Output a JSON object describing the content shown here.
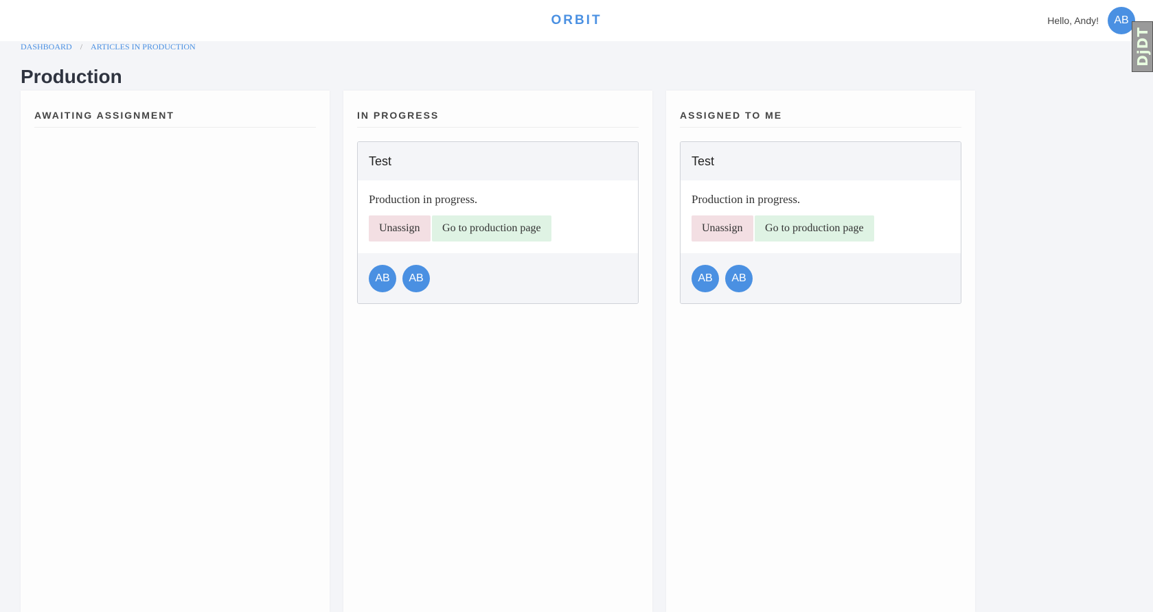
{
  "header": {
    "brand": "ORBIT",
    "greeting": "Hello, Andy!",
    "user_initials": "AB",
    "debug_toolbar": "DjDT"
  },
  "breadcrumb": {
    "items": [
      "DASHBOARD",
      "ARTICLES IN PRODUCTION"
    ],
    "separator": "/"
  },
  "page_title": "Production",
  "columns": [
    {
      "title": "AWAITING ASSIGNMENT",
      "cards": []
    },
    {
      "title": "IN PROGRESS",
      "cards": [
        {
          "title": "Test",
          "text": "Production in progress.",
          "unassign_label": "Unassign",
          "goto_label": "Go to production page",
          "assignees": [
            "AB",
            "AB"
          ]
        }
      ]
    },
    {
      "title": "ASSIGNED TO ME",
      "cards": [
        {
          "title": "Test",
          "text": "Production in progress.",
          "unassign_label": "Unassign",
          "goto_label": "Go to production page",
          "assignees": [
            "AB",
            "AB"
          ]
        }
      ]
    }
  ],
  "colors": {
    "accent": "#4a90e2",
    "unassign_bg": "#f3dfe3",
    "goto_bg": "#dff3e4",
    "page_bg": "#f4f5f8"
  }
}
